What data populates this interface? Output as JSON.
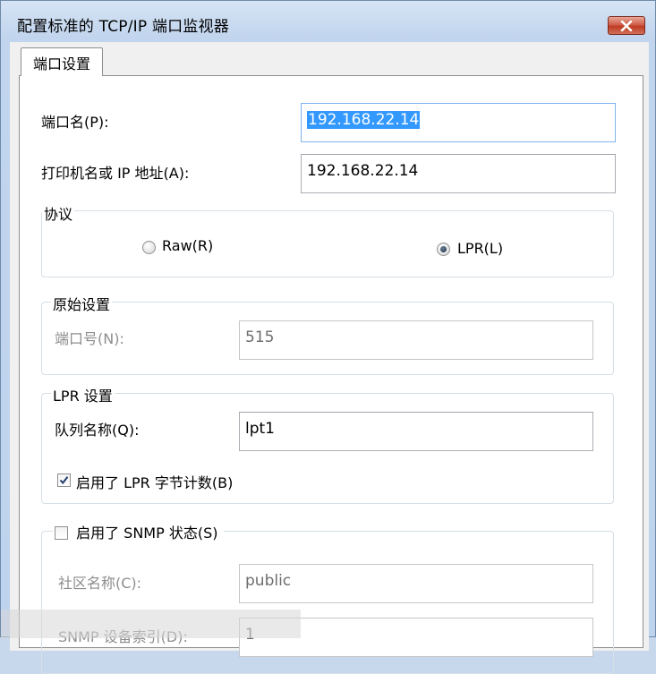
{
  "window": {
    "title": "配置标准的 TCP/IP 端口监视器",
    "close_icon": "close-icon"
  },
  "tabs": [
    {
      "label": "端口设置",
      "active": true
    }
  ],
  "port_name": {
    "label": "端口名(P):",
    "value": "192.168.22.14"
  },
  "printer_address": {
    "label": "打印机名或 IP 地址(A):",
    "value": "192.168.22.14"
  },
  "protocol": {
    "legend": "协议",
    "options": [
      {
        "label": "Raw(R)",
        "selected": false
      },
      {
        "label": "LPR(L)",
        "selected": true
      }
    ]
  },
  "raw_settings": {
    "legend": "原始设置",
    "port_number_label": "端口号(N):",
    "port_number_value": "515"
  },
  "lpr_settings": {
    "legend": "LPR 设置",
    "queue_label": "队列名称(Q):",
    "queue_value": "lpt1",
    "byte_count_label": "启用了 LPR 字节计数(B)",
    "byte_count_checked": true
  },
  "snmp": {
    "enable_label": "启用了 SNMP 状态(S)",
    "enabled": false,
    "community_label": "社区名称(C):",
    "community_value": "public",
    "device_index_label": "SNMP 设备索引(D):",
    "device_index_value": "1"
  }
}
